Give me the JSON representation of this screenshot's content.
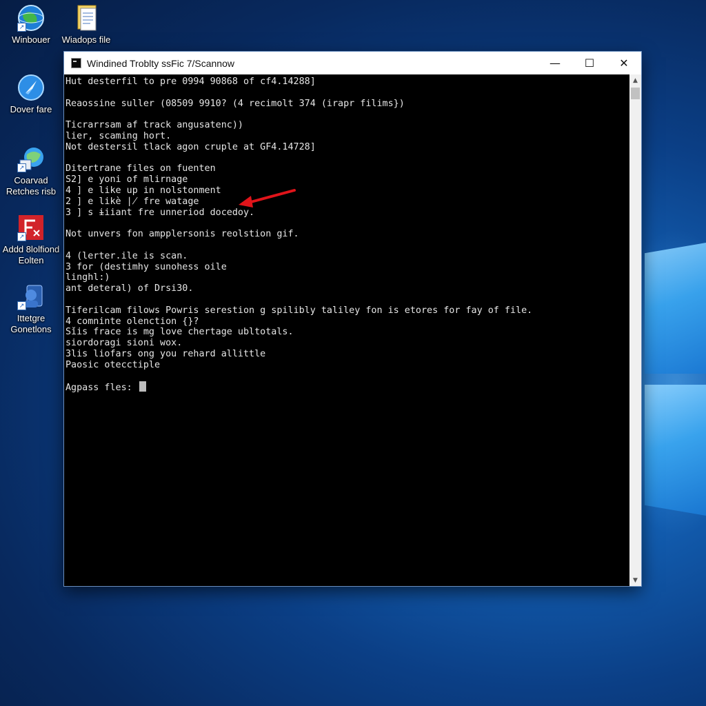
{
  "desktop": {
    "icons": [
      {
        "label": "Winbouer",
        "icon": "globe-icon"
      },
      {
        "label": "Wiadops file",
        "icon": "document-icon"
      },
      {
        "label": "Dover fare",
        "icon": "edge-icon"
      },
      {
        "label": "Coarvad Retches risb",
        "icon": "network-icon"
      },
      {
        "label": "Addd 8lolfiond Eolten",
        "icon": "red-app-icon"
      },
      {
        "label": "Ittetgre Gonetlons",
        "icon": "user-icon"
      }
    ]
  },
  "window": {
    "title": "Windined Troblty ssFic 7/Scannow",
    "controls": {
      "minimize": "—",
      "maximize": "☐",
      "close": "✕"
    }
  },
  "console": {
    "lines": [
      "Hut desterfil to pre 0994 90868 of cf4.14288]",
      "",
      "Reaossine suller (08509 9910? (4 recimolt 374 (irapr filims})",
      "",
      "Ticrarrsam af track angusatenc))",
      "lier, scaming hort.",
      "Not destersil tlack agon cruple at GF4.14728]",
      "",
      "Ditertrane files on fuenten",
      "S2] e yoni of mlirnage",
      "4 ] e like up in nolstonment",
      "2 ] e likè ∤ fre watage",
      "3 ] s ɨiiant fre unneriod docedoy.",
      "",
      "Not unvers fon ampplersonis reolstion gif.",
      "",
      "4 (lerter.ile is scan.",
      "3 for (destimhy sunohess oile",
      "linghl:)",
      "ant deteral) of Drsi30.",
      "",
      "Tiferilcam filows Powris serestion g spilibly taliley fon is etores for fay of file.",
      "4 comninte olenction {}?",
      "Sǐis frace is mg love chertage ubltotals.",
      "siordoragi sioni wox.",
      "3lis liofars ong you rehard allittle",
      "Paosic otecctiple",
      ""
    ],
    "prompt": "Agpass fles:"
  },
  "annotation": {
    "color": "#e0141a"
  }
}
